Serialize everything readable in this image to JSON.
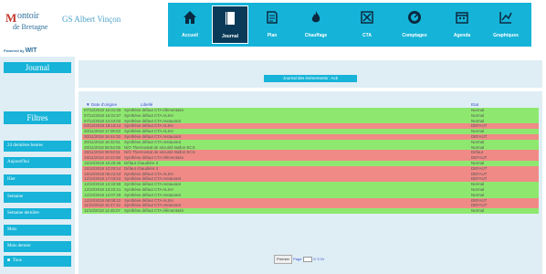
{
  "header": {
    "logo_line1": "ontoir",
    "logo_line2": "de Bretagne",
    "site_title": "GS Albert Vinçon",
    "powered_by": "Powered by",
    "powered_brand": "WIT"
  },
  "nav": [
    {
      "label": "Accueil",
      "icon": "home-icon"
    },
    {
      "label": "Journal",
      "icon": "journal-icon",
      "active": true
    },
    {
      "label": "Plan",
      "icon": "plan-icon"
    },
    {
      "label": "Chauffage",
      "icon": "flame-icon"
    },
    {
      "label": "CTA",
      "icon": "cta-icon"
    },
    {
      "label": "Comptages",
      "icon": "gauge-icon"
    },
    {
      "label": "Agenda",
      "icon": "calendar-icon"
    },
    {
      "label": "Graphiques",
      "icon": "chart-icon"
    }
  ],
  "sidebar": {
    "journal_label": "Journal",
    "filters_label": "Filtres",
    "filters": [
      "24 dernières heures",
      "Aujourd'hui",
      "Hier",
      "Semaine",
      "Semaine dernière",
      "Mois",
      "Mois dernier",
      "Tous"
    ]
  },
  "main": {
    "title": "Journal des évènements : Ack",
    "columns": {
      "date": "▼ Date d'origine",
      "libelle": "Libellé",
      "etat": "Etat"
    },
    "rows": [
      {
        "date": "07/12/2018 16:31:55",
        "libelle": "Synthèse défaut CTA élémentaire",
        "etat": "Normal",
        "status": "ok"
      },
      {
        "date": "07/12/2018 16:31:57",
        "libelle": "Synthèse défaut CTA ALSH",
        "etat": "Normal",
        "status": "ok"
      },
      {
        "date": "07/12/2018 14:44:02",
        "libelle": "Synthèse défaut CTA restaurant",
        "etat": "Normal",
        "status": "ok"
      },
      {
        "date": "03/12/2018 18:16:14",
        "libelle": "Synthèse défaut CTA ALSH",
        "etat": "DEFAUT",
        "status": "bad"
      },
      {
        "date": "30/11/2018 17:09:53",
        "libelle": "Synthèse défaut CTA ALSH",
        "etat": "Normal",
        "status": "ok"
      },
      {
        "date": "30/11/2018 16:44:33",
        "libelle": "Synthèse défaut CTA restaurant",
        "etat": "DEFAUT",
        "status": "bad"
      },
      {
        "date": "30/11/2018 15:32:51",
        "libelle": "Synthèse défaut CTA restaurant",
        "etat": "Normal",
        "status": "ok"
      },
      {
        "date": "29/11/2018 08:54:09",
        "libelle": "N/O Thermostat de sécurité Ballon ECS",
        "etat": "Normal",
        "status": "ok"
      },
      {
        "date": "28/11/2018 08:53:51",
        "libelle": "N/O Thermostat de sécurité Ballon ECS",
        "etat": "Défaut",
        "status": "bad"
      },
      {
        "date": "15/11/2018 10:22:58",
        "libelle": "Synthèse défaut CTA élémentaire",
        "etat": "DEFAUT",
        "status": "bad"
      },
      {
        "date": "15/10/2018 10:25:36",
        "libelle": "Défaut chaudière 3",
        "etat": "Normal",
        "status": "ok"
      },
      {
        "date": "15/10/2018 10:25:14",
        "libelle": "Défaut chaudière 3",
        "etat": "DEFAUT",
        "status": "bad"
      },
      {
        "date": "15/10/2018 09:22:53",
        "libelle": "Synthèse défaut CTA ALSH",
        "etat": "DEFAUT",
        "status": "bad"
      },
      {
        "date": "12/10/2018 17:03:53",
        "libelle": "Synthèse défaut CTA restaurant",
        "etat": "DEFAUT",
        "status": "bad"
      },
      {
        "date": "12/10/2018 13:32:59",
        "libelle": "Synthèse défaut CTA restaurant",
        "etat": "Normal",
        "status": "ok"
      },
      {
        "date": "12/10/2018 13:22:41",
        "libelle": "Synthèse défaut CTA ALSH",
        "etat": "Normal",
        "status": "ok"
      },
      {
        "date": "12/10/2018 12:07:29",
        "libelle": "Synthèse défaut CTA restaurant",
        "etat": "Normal",
        "status": "ok"
      },
      {
        "date": "12/10/2018 08:08:22",
        "libelle": "Synthèse défaut CTA ALSH",
        "etat": "DEFAUT",
        "status": "bad"
      },
      {
        "date": "11/10/2018 15:47:42",
        "libelle": "Synthèse défaut CTA restaurant",
        "etat": "DEFAUT",
        "status": "bad"
      },
      {
        "date": "11/10/2018 14:45:07",
        "libelle": "Synthèse défaut CTA élémentaire",
        "etat": "Normal",
        "status": "ok"
      }
    ],
    "pager": {
      "first_label": "Premier",
      "page_label": "Page",
      "of_label": "/1",
      "next": "S",
      "last": "Dr"
    }
  }
}
